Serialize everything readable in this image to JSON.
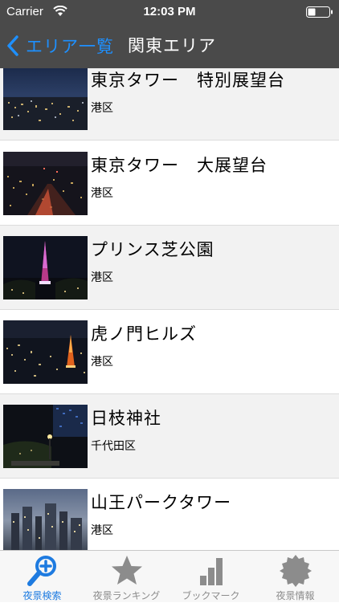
{
  "status_bar": {
    "carrier": "Carrier",
    "time": "12:03 PM"
  },
  "nav": {
    "back_label": "エリア一覧",
    "title": "関東エリア"
  },
  "spots": [
    {
      "name": "東京タワー　特別展望台",
      "area": "港区"
    },
    {
      "name": "東京タワー　大展望台",
      "area": "港区"
    },
    {
      "name": "プリンス芝公園",
      "area": "港区"
    },
    {
      "name": "虎ノ門ヒルズ",
      "area": "港区"
    },
    {
      "name": "日枝神社",
      "area": "千代田区"
    },
    {
      "name": "山王パークタワー",
      "area": "港区"
    }
  ],
  "tabs": [
    {
      "label": "夜景検索",
      "icon": "magnifier-plus-icon",
      "active": true
    },
    {
      "label": "夜景ランキング",
      "icon": "star-icon",
      "active": false
    },
    {
      "label": "ブックマーク",
      "icon": "bar-chart-icon",
      "active": false
    },
    {
      "label": "夜景情報",
      "icon": "gear-badge-icon",
      "active": false
    }
  ],
  "colors": {
    "bar_background": "#4a4a4a",
    "accent": "#1e90ff",
    "tab_active": "#1e7be0",
    "tab_inactive": "#8c8c8c",
    "row_alt": "#f2f2f2"
  }
}
